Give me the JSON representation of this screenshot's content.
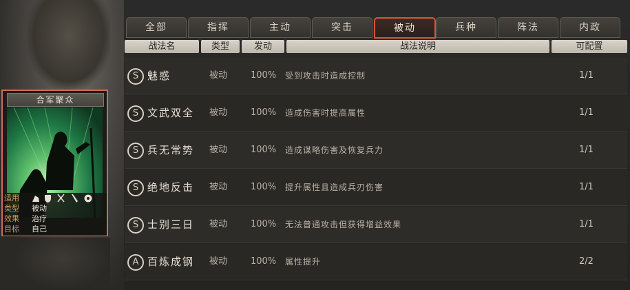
{
  "tabs": [
    {
      "label": "全部"
    },
    {
      "label": "指挥"
    },
    {
      "label": "主动"
    },
    {
      "label": "突击"
    },
    {
      "label": "被动"
    },
    {
      "label": "兵种"
    },
    {
      "label": "阵法"
    },
    {
      "label": "内政"
    }
  ],
  "active_tab": "被动",
  "columns": {
    "name": "战法名",
    "type": "类型",
    "trigger": "发动",
    "description": "战法说明",
    "configurable": "可配置"
  },
  "tactics": [
    {
      "grade": "S",
      "name": "魅惑",
      "type": "被动",
      "rate": "100%",
      "description": "受到攻击时造成控制",
      "count": "1/1"
    },
    {
      "grade": "S",
      "name": "文武双全",
      "type": "被动",
      "rate": "100%",
      "description": "造成伤害时提高属性",
      "count": "1/1"
    },
    {
      "grade": "S",
      "name": "兵无常势",
      "type": "被动",
      "rate": "100%",
      "description": "造成谋略伤害及恢复兵力",
      "count": "1/1"
    },
    {
      "grade": "S",
      "name": "绝地反击",
      "type": "被动",
      "rate": "100%",
      "description": "提升属性且造成兵刃伤害",
      "count": "1/1"
    },
    {
      "grade": "S",
      "name": "士别三日",
      "type": "被动",
      "rate": "100%",
      "description": "无法普通攻击但获得增益效果",
      "count": "1/1"
    },
    {
      "grade": "A",
      "name": "百炼成钢",
      "type": "被动",
      "rate": "100%",
      "description": "属性提升",
      "count": "2/2"
    }
  ],
  "card": {
    "title": "合军聚众",
    "info": [
      {
        "key": "适用",
        "value": ""
      },
      {
        "key": "类型",
        "value": "被动"
      },
      {
        "key": "效果",
        "value": "治疗"
      },
      {
        "key": "目标",
        "value": "自己"
      }
    ],
    "unit_icons": [
      "cavalry-icon",
      "shield-icon",
      "bow-icon",
      "spear-icon",
      "wheel-icon"
    ]
  },
  "colors": {
    "active_tab_border": "#d8553a",
    "card_border": "#d06a5a",
    "info_key": "#d19a5c"
  }
}
